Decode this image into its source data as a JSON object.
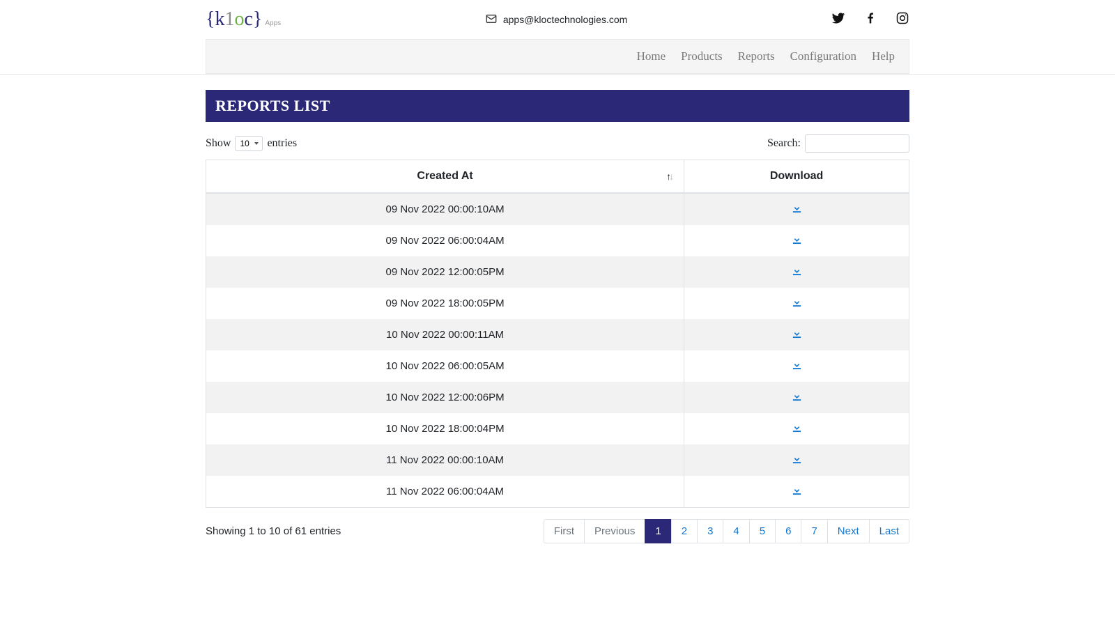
{
  "header": {
    "logo_text_parts": {
      "open": "{",
      "k": "k",
      "one": "1",
      "o": "o",
      "c": "c",
      "close": "}"
    },
    "logo_sub": "Apps",
    "email": "apps@kloctechnologies.com"
  },
  "nav": {
    "items": [
      "Home",
      "Products",
      "Reports",
      "Configuration",
      "Help"
    ]
  },
  "page": {
    "title": "REPORTS LIST"
  },
  "controls": {
    "show_label_pre": "Show",
    "show_label_post": "entries",
    "page_size_options": [
      "10"
    ],
    "page_size_selected": "10",
    "search_label": "Search:"
  },
  "table": {
    "columns": {
      "created_at": "Created At",
      "download": "Download"
    },
    "rows": [
      {
        "created_at": "09 Nov 2022 00:00:10AM"
      },
      {
        "created_at": "09 Nov 2022 06:00:04AM"
      },
      {
        "created_at": "09 Nov 2022 12:00:05PM"
      },
      {
        "created_at": "09 Nov 2022 18:00:05PM"
      },
      {
        "created_at": "10 Nov 2022 00:00:11AM"
      },
      {
        "created_at": "10 Nov 2022 06:00:05AM"
      },
      {
        "created_at": "10 Nov 2022 12:00:06PM"
      },
      {
        "created_at": "10 Nov 2022 18:00:04PM"
      },
      {
        "created_at": "11 Nov 2022 00:00:10AM"
      },
      {
        "created_at": "11 Nov 2022 06:00:04AM"
      }
    ]
  },
  "footer": {
    "showing_text": "Showing 1 to 10 of 61 entries"
  },
  "pagination": {
    "first": "First",
    "previous": "Previous",
    "pages": [
      "1",
      "2",
      "3",
      "4",
      "5",
      "6",
      "7"
    ],
    "active_page": "1",
    "next": "Next",
    "last": "Last"
  }
}
